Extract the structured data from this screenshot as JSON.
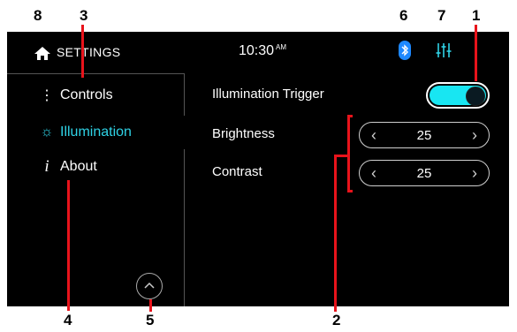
{
  "header": {
    "title": "SETTINGS",
    "time": "10:30",
    "ampm": "AM"
  },
  "icons": {
    "home": "home-icon",
    "bluetooth": "bluetooth-icon",
    "equalizer": "equalizer-icon",
    "controls": "vertical-dots-icon",
    "illumination": "sun-icon",
    "about": "info-icon",
    "scroll_up": "chevron-up-icon"
  },
  "sidebar": {
    "items": [
      {
        "label": "Controls",
        "icon": "⋮",
        "active": false
      },
      {
        "label": "Illumination",
        "icon": "☼",
        "active": true
      },
      {
        "label": "About",
        "icon": "i",
        "active": false
      }
    ]
  },
  "settings": {
    "trigger": {
      "label": "Illumination Trigger",
      "enabled": true
    },
    "brightness": {
      "label": "Brightness",
      "value": "25"
    },
    "contrast": {
      "label": "Contrast",
      "value": "25"
    }
  },
  "callouts": {
    "c1": "1",
    "c2": "2",
    "c3": "3",
    "c4": "4",
    "c5": "5",
    "c6": "6",
    "c7": "7",
    "c8": "8"
  },
  "colors": {
    "accent": "#2fd3e6",
    "toggle_on": "#18e6f2",
    "callout_red": "#e8131b",
    "bluetooth_blue": "#1e88ff",
    "screen_bg": "#000000"
  }
}
